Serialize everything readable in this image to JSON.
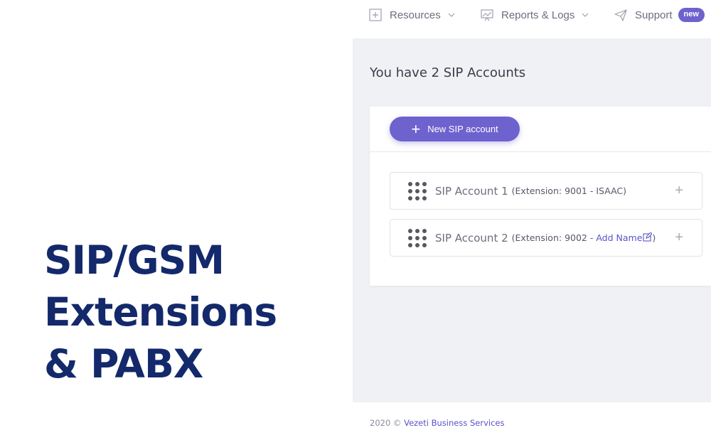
{
  "hero": {
    "line1": "SIP/GSM",
    "line2": "Extensions",
    "line3": "& PABX"
  },
  "nav": {
    "resources": "Resources",
    "reports": "Reports & Logs",
    "support": "Support",
    "support_badge": "new"
  },
  "page": {
    "title": "You have 2 SIP Accounts"
  },
  "actions": {
    "new_sip": "New SIP account"
  },
  "accounts": [
    {
      "name": "SIP Account 1",
      "ext_prefix": "(Extension: 9001 - ISAAC)",
      "add_name": "",
      "ext_suffix": ""
    },
    {
      "name": "SIP Account 2",
      "ext_prefix": "(Extension: 9002 - ",
      "add_name": "Add Name",
      "ext_suffix": ")"
    }
  ],
  "footer": {
    "year": "2020 ©",
    "company": "Vezeti Business Services"
  },
  "colors": {
    "accent": "#6e62cf",
    "hero_text": "#13296b",
    "content_bg": "#f0f1f5"
  },
  "icons": {
    "resources": "plus-square-icon",
    "reports": "chart-presentation-icon",
    "support": "paper-plane-icon",
    "account": "dialpad-icon",
    "edit": "edit-icon",
    "expand": "plus-icon"
  }
}
